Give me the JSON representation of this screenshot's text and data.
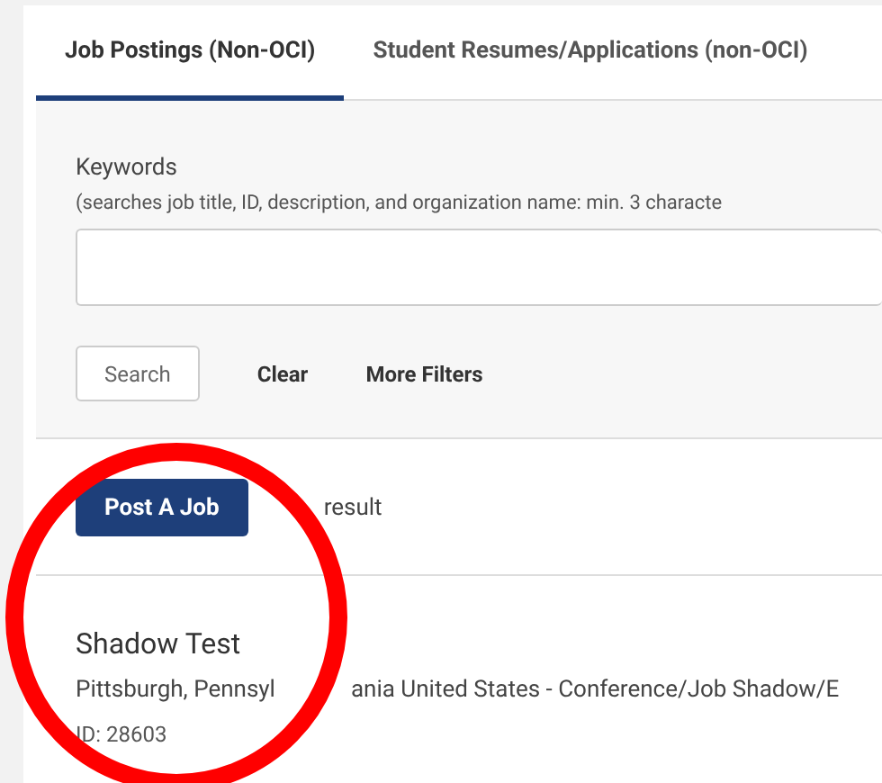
{
  "tabs": [
    {
      "label": "Job Postings (Non-OCI)",
      "selected": true
    },
    {
      "label": "Student Resumes/Applications (non-OCI)",
      "selected": false
    }
  ],
  "search": {
    "label": "Keywords",
    "hint": "(searches job title, ID, description, and organization name: min. 3 characte",
    "buttons": [
      "Search",
      "Clear",
      "More Filters"
    ]
  },
  "results": {
    "action": "Post A Job",
    "count": "result"
  },
  "postings": [
    {
      "title": "Shadow Test",
      "location": [
        "Pittsburgh, Pennsyl",
        "ania United States - Conference/Job Shadow/E"
      ],
      "id": "ID: 28603"
    }
  ],
  "annotation": {
    "kind": "circle",
    "color": "#ff0000"
  }
}
